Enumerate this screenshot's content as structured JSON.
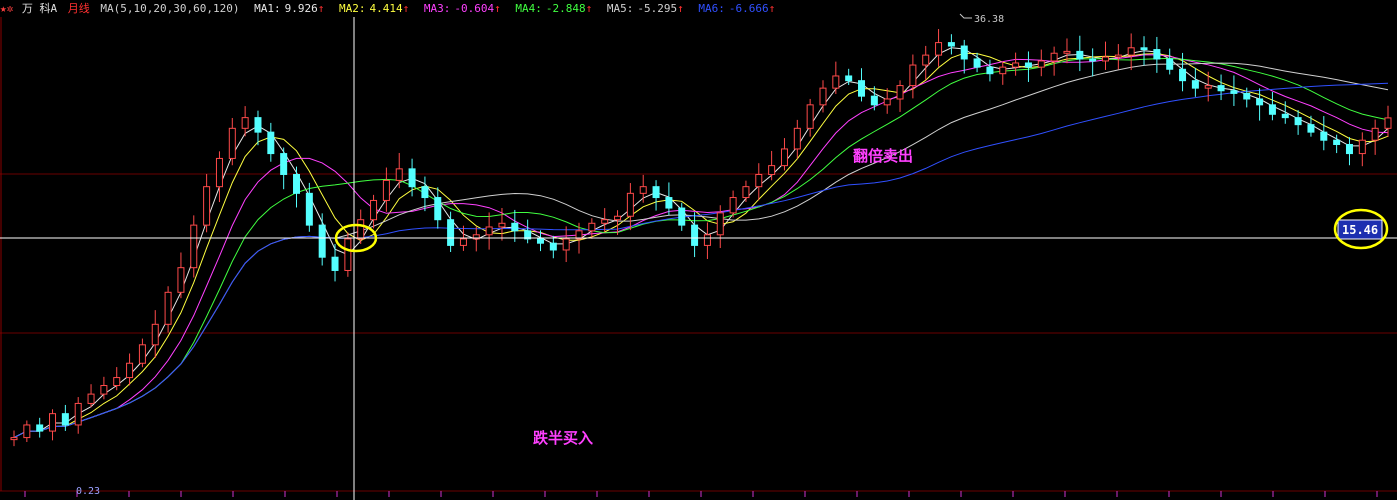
{
  "header": {
    "icons": [
      "star-icon",
      "gear-icon"
    ],
    "stock_name": "万 科A",
    "period": "月线",
    "ma_params": "MA(5,10,20,30,60,120)",
    "ma": [
      {
        "label": "MA1:",
        "value": "9.926",
        "color": "#e8e8e8"
      },
      {
        "label": "MA2:",
        "value": "4.414",
        "color": "#ffff40"
      },
      {
        "label": "MA3:",
        "value": "-0.604",
        "color": "#ff40ff"
      },
      {
        "label": "MA4:",
        "value": "-2.848",
        "color": "#40ff40"
      },
      {
        "label": "MA5:",
        "value": "-5.295",
        "color": "#d0d0d0"
      },
      {
        "label": "MA6:",
        "value": "-6.666",
        "color": "#3050ff"
      }
    ],
    "up_arrow": "↑"
  },
  "chart_data": {
    "type": "candlestick",
    "high_label": "36.38",
    "low_label": "0.23",
    "price_tag": "15.46",
    "annotations": [
      "翻倍卖出",
      "跌半买入"
    ],
    "price_series": [
      0.5,
      0.6,
      0.55,
      0.7,
      0.6,
      0.8,
      0.9,
      1.0,
      1.1,
      1.3,
      1.6,
      2.0,
      2.8,
      3.6,
      5.5,
      8.0,
      10.5,
      14.0,
      15.5,
      13.5,
      11.0,
      9.0,
      7.5,
      5.5,
      4.0,
      3.5,
      4.8,
      5.8,
      7.0,
      8.5,
      9.5,
      8.0,
      7.2,
      5.8,
      4.5,
      4.8,
      5.0,
      5.4,
      5.6,
      5.2,
      4.8,
      4.6,
      4.3,
      4.8,
      5.2,
      5.6,
      5.8,
      6.0,
      7.5,
      8.0,
      7.2,
      6.5,
      5.5,
      4.5,
      5.0,
      6.2,
      7.2,
      8.0,
      9.0,
      9.8,
      11.5,
      14.0,
      17.5,
      20.5,
      23.0,
      22.0,
      19.0,
      17.5,
      18.5,
      21.0,
      25.5,
      28.0,
      31.5,
      30.5,
      27.0,
      25.0,
      23.5,
      25.0,
      26.0,
      25.0,
      26.5,
      28.5,
      29.0,
      27.0,
      26.5,
      27.5,
      28.0,
      30.0,
      29.5,
      27.0,
      24.5,
      22.0,
      20.5,
      21.0,
      20.0,
      19.5,
      18.5,
      17.5,
      16.0,
      15.5,
      14.5,
      13.5,
      12.5,
      12.0,
      11.0,
      12.5,
      14.0,
      15.46
    ],
    "ma_series": {
      "MA5": [
        0.5,
        0.55,
        0.55,
        0.6,
        0.6,
        0.65,
        0.7,
        0.8,
        0.9,
        1.05,
        1.25,
        1.5,
        1.9,
        2.4,
        3.2,
        4.4,
        6.0,
        8.2,
        10.5,
        12.0,
        12.8,
        12.4,
        11.0,
        9.5,
        7.5,
        5.9,
        5.1,
        5.0,
        5.3,
        6.3,
        7.4,
        8.0,
        8.3,
        8.1,
        7.6,
        6.7,
        6.0,
        5.2,
        5.1,
        5.2,
        5.2,
        5.1,
        4.9,
        4.7,
        4.8,
        5.0,
        5.3,
        5.5,
        6.0,
        6.6,
        6.9,
        6.9,
        6.7,
        6.5,
        5.9,
        5.9,
        6.0,
        6.4,
        7.0,
        8.0,
        9.0,
        10.6,
        12.5,
        14.6,
        17.0,
        19.6,
        20.5,
        20.4,
        19.8,
        19.8,
        20.7,
        22.0,
        24.9,
        27.3,
        28.5,
        28.4,
        27.5,
        26.2,
        25.3,
        24.9,
        25.2,
        26.2,
        27.0,
        27.1,
        27.5,
        27.7,
        27.7,
        27.8,
        28.2,
        28.4,
        28.1,
        26.6,
        24.8,
        23.0,
        21.6,
        20.6,
        19.9,
        19.3,
        18.3,
        17.4,
        16.6,
        15.4,
        14.4,
        13.6,
        12.7,
        12.3,
        12.4,
        13.0
      ]
    }
  }
}
